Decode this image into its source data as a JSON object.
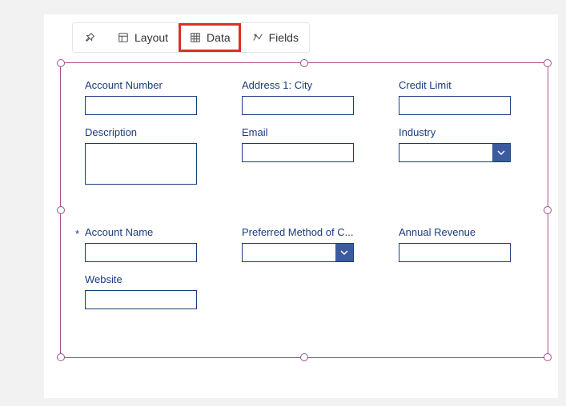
{
  "toolbar": {
    "layout_label": "Layout",
    "data_label": "Data",
    "fields_label": "Fields"
  },
  "fields": {
    "account_number": {
      "label": "Account Number"
    },
    "address_city": {
      "label": "Address 1: City"
    },
    "credit_limit": {
      "label": "Credit Limit"
    },
    "description": {
      "label": "Description"
    },
    "email": {
      "label": "Email"
    },
    "industry": {
      "label": "Industry"
    },
    "account_name": {
      "label": "Account Name",
      "required_marker": "*"
    },
    "preferred_method": {
      "label": "Preferred Method of C..."
    },
    "annual_revenue": {
      "label": "Annual Revenue"
    },
    "website": {
      "label": "Website"
    }
  }
}
